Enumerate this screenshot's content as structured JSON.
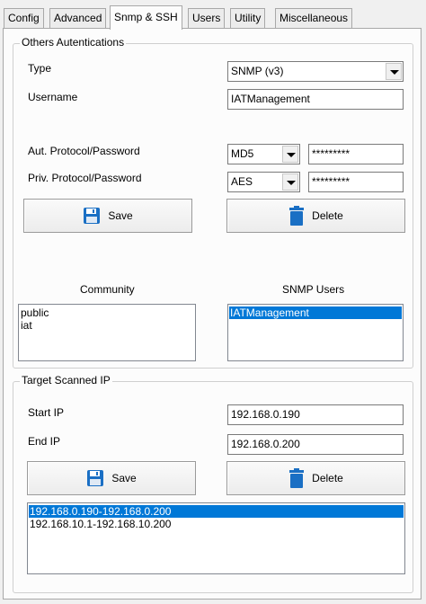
{
  "tabs": [
    {
      "label": "Config"
    },
    {
      "label": "Advanced"
    },
    {
      "label": "Snmp & SSH",
      "active": true
    },
    {
      "label": "Users"
    },
    {
      "label": "Utility"
    },
    {
      "label": "Miscellaneous"
    }
  ],
  "auth": {
    "legend": "Others Autentications",
    "type_label": "Type",
    "type_value": "SNMP (v3)",
    "username_label": "Username",
    "username_value": "IATManagement",
    "aut_label": "Aut. Protocol/Password",
    "aut_protocol": "MD5",
    "aut_password": "*********",
    "priv_label": "Priv. Protocol/Password",
    "priv_protocol": "AES",
    "priv_password": "*********",
    "save_label": "Save",
    "delete_label": "Delete",
    "community_header": "Community",
    "community_items": [
      "public",
      "iat"
    ],
    "snmp_users_header": "SNMP Users",
    "snmp_users_items": [
      "IATManagement"
    ]
  },
  "target": {
    "legend": "Target Scanned IP",
    "start_label": "Start IP",
    "start_value": "192.168.0.190",
    "end_label": "End IP",
    "end_value": "192.168.0.200",
    "save_label": "Save",
    "delete_label": "Delete",
    "ranges": [
      "192.168.0.190-192.168.0.200",
      "192.168.10.1-192.168.10.200"
    ]
  },
  "colors": {
    "selection": "#0078d7",
    "icon_blue": "#1a6fc4"
  },
  "icons": {
    "save": "floppy-disk-icon",
    "delete": "trash-can-icon"
  }
}
